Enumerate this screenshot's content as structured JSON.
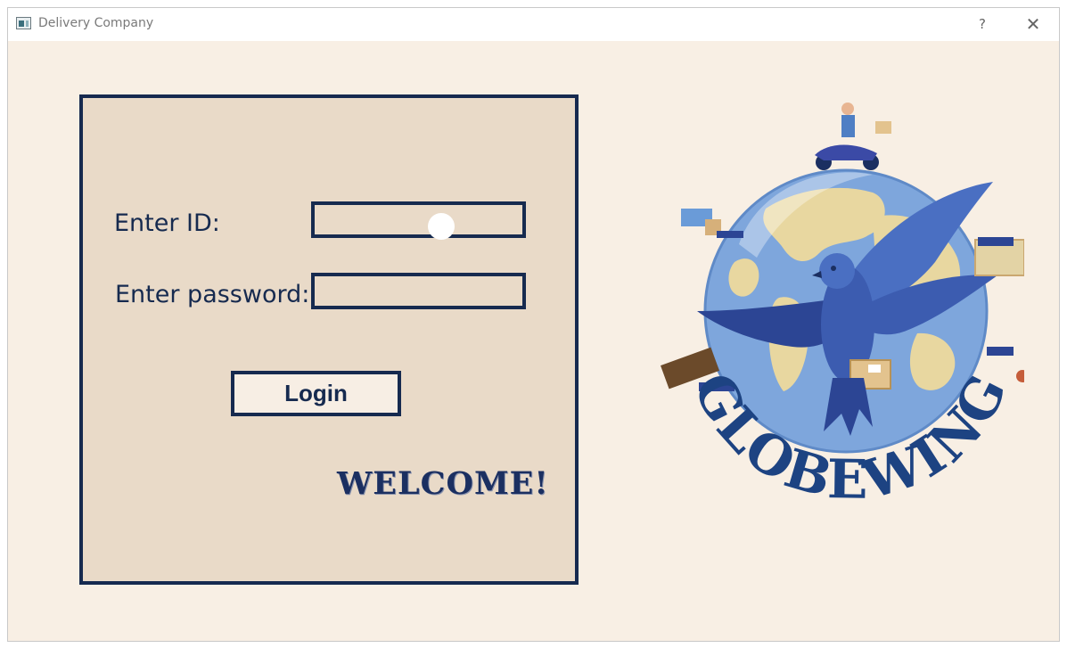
{
  "window": {
    "title": "Delivery Company",
    "help": "?",
    "close": "✕"
  },
  "login": {
    "id_label": "Enter ID:",
    "password_label": "Enter password:",
    "id_value": "",
    "password_value": "",
    "button_label": "Login",
    "welcome": "WELCOME!"
  },
  "logo": {
    "text": "GLOBEWING"
  },
  "colors": {
    "navy": "#162a4f",
    "panel": "#e9dac8",
    "background": "#f8efe4",
    "globe": "#6f9bd8",
    "land": "#e8d7a0"
  }
}
